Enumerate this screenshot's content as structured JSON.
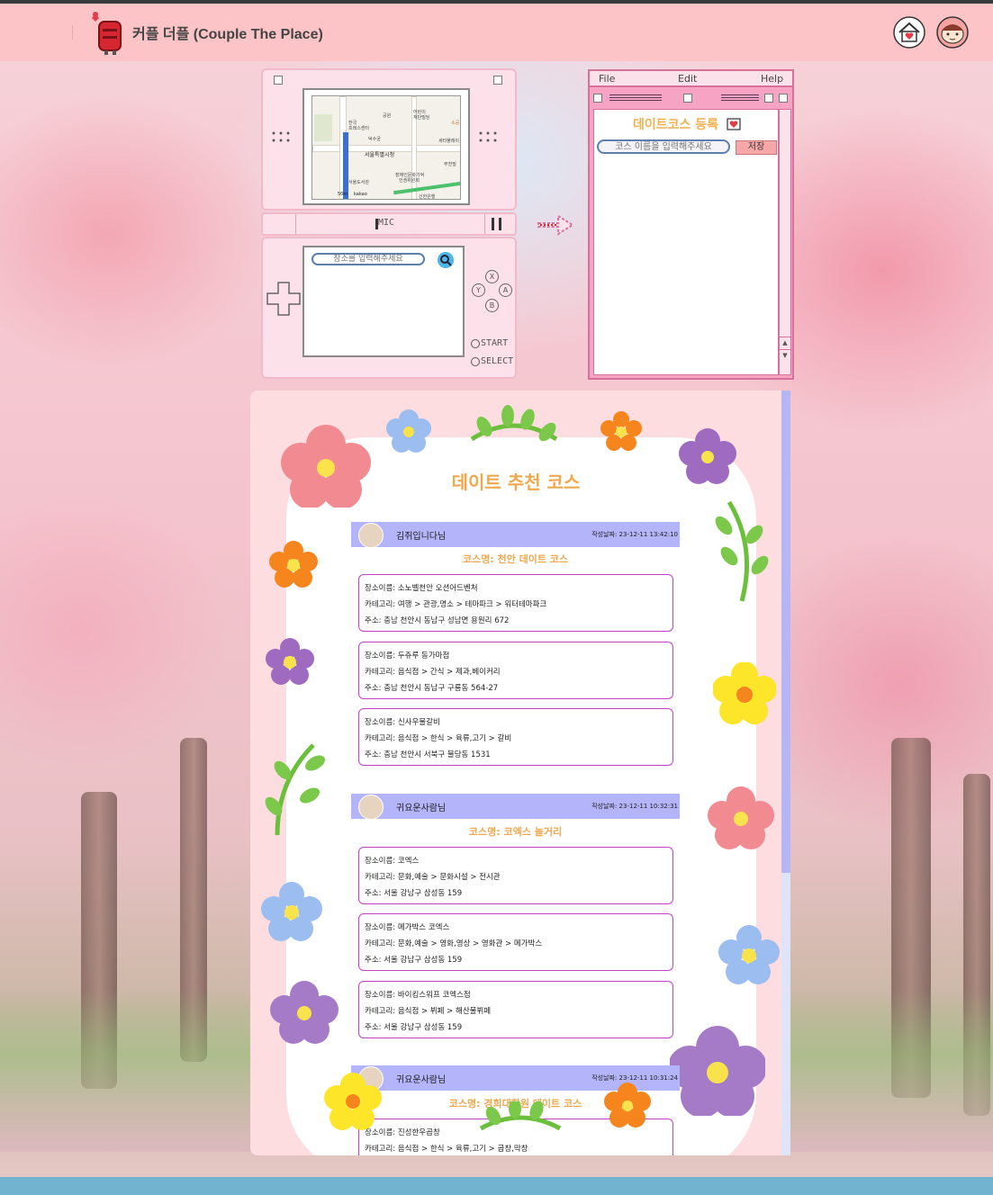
{
  "header": {
    "site_title": "커플 더플 (Couple The Place)"
  },
  "ds": {
    "mic_label": "MIC",
    "search_placeholder": "장소를 입력해주세요",
    "buttons": {
      "x": "X",
      "y": "Y",
      "a": "A",
      "b": "B"
    },
    "start_label": "START",
    "select_label": "SELECT",
    "map_labels": [
      "한국",
      "프레스센터",
      "덕수궁",
      "서울특별시청",
      "서울도서관",
      "50m",
      "kakao",
      "프레스센터",
      "공원",
      "어린이",
      "재단빌딩",
      "부천빌",
      "장애인문화기억",
      "인권위원회",
      "신한은행",
      "소공",
      "세터플레이"
    ]
  },
  "register_window": {
    "menu": [
      "File",
      "Edit",
      "Help"
    ],
    "title": "데이트코스 등록",
    "course_input_placeholder": "코스 이름을 입력해주세요",
    "save_label": "저장"
  },
  "feed": {
    "title": "데이트 추천 코스",
    "posts": [
      {
        "user": "김쥐입니다님",
        "date": "작성날짜: 23-12-11 13:42:10",
        "course": "코스명: 천안 데이트 코스",
        "places": [
          {
            "name": "장소이름: 소노벨천안 오션어드벤처",
            "category": "카테고리: 여행 > 관광,명소 > 테마파크 > 워터테마파크",
            "address": "주소: 충남 천안시 동남구 성남면 용원리 672"
          },
          {
            "name": "장소이름: 두쥬루 동가마점",
            "category": "카테고리: 음식점 > 간식 > 제과,베이커리",
            "address": "주소: 충남 천안시 동남구 구룡동 564-27"
          },
          {
            "name": "장소이름: 신사우물갈비",
            "category": "카테고리: 음식점 > 한식 > 육류,고기 > 갈비",
            "address": "주소: 충남 천안시 서북구 불당동 1531"
          }
        ]
      },
      {
        "user": "귀요운사람님",
        "date": "작성날짜: 23-12-11 10:32:31",
        "course": "코스명: 코엑스 놀거리",
        "places": [
          {
            "name": "장소이름: 코엑스",
            "category": "카테고리: 문화,예술 > 문화시설 > 전시관",
            "address": "주소: 서울 강남구 삼성동 159"
          },
          {
            "name": "장소이름: 메가박스 코엑스",
            "category": "카테고리: 문화,예술 > 영화,영상 > 영화관 > 메가박스",
            "address": "주소: 서울 강남구 삼성동 159"
          },
          {
            "name": "장소이름: 바이킹스워프 코엑스점",
            "category": "카테고리: 음식점 > 뷔페 > 해산물뷔페",
            "address": "주소: 서울 강남구 삼성동 159"
          }
        ]
      },
      {
        "user": "귀요운사람님",
        "date": "작성날짜: 23-12-11 10:31:24",
        "course": "코스명: 경희대학원 데이트 코스",
        "places": [
          {
            "name": "장소이름: 진성한우곱창",
            "category": "카테고리: 음식점 > 한식 > 육류,고기 > 곱창,막창",
            "address": ""
          }
        ]
      }
    ]
  },
  "colors": {
    "header_bg": "#fcc4c6",
    "accent_orange": "#f0a84f",
    "post_header": "#b4b4fb",
    "card_border": "#c63fc9",
    "window_pink": "#f6a3c4"
  },
  "icons": [
    "mailbox-logo-icon",
    "home-heart-icon",
    "profile-avatar-icon",
    "search-icon",
    "dpad-icon",
    "arrow-right-icon",
    "heart-letter-icon"
  ]
}
